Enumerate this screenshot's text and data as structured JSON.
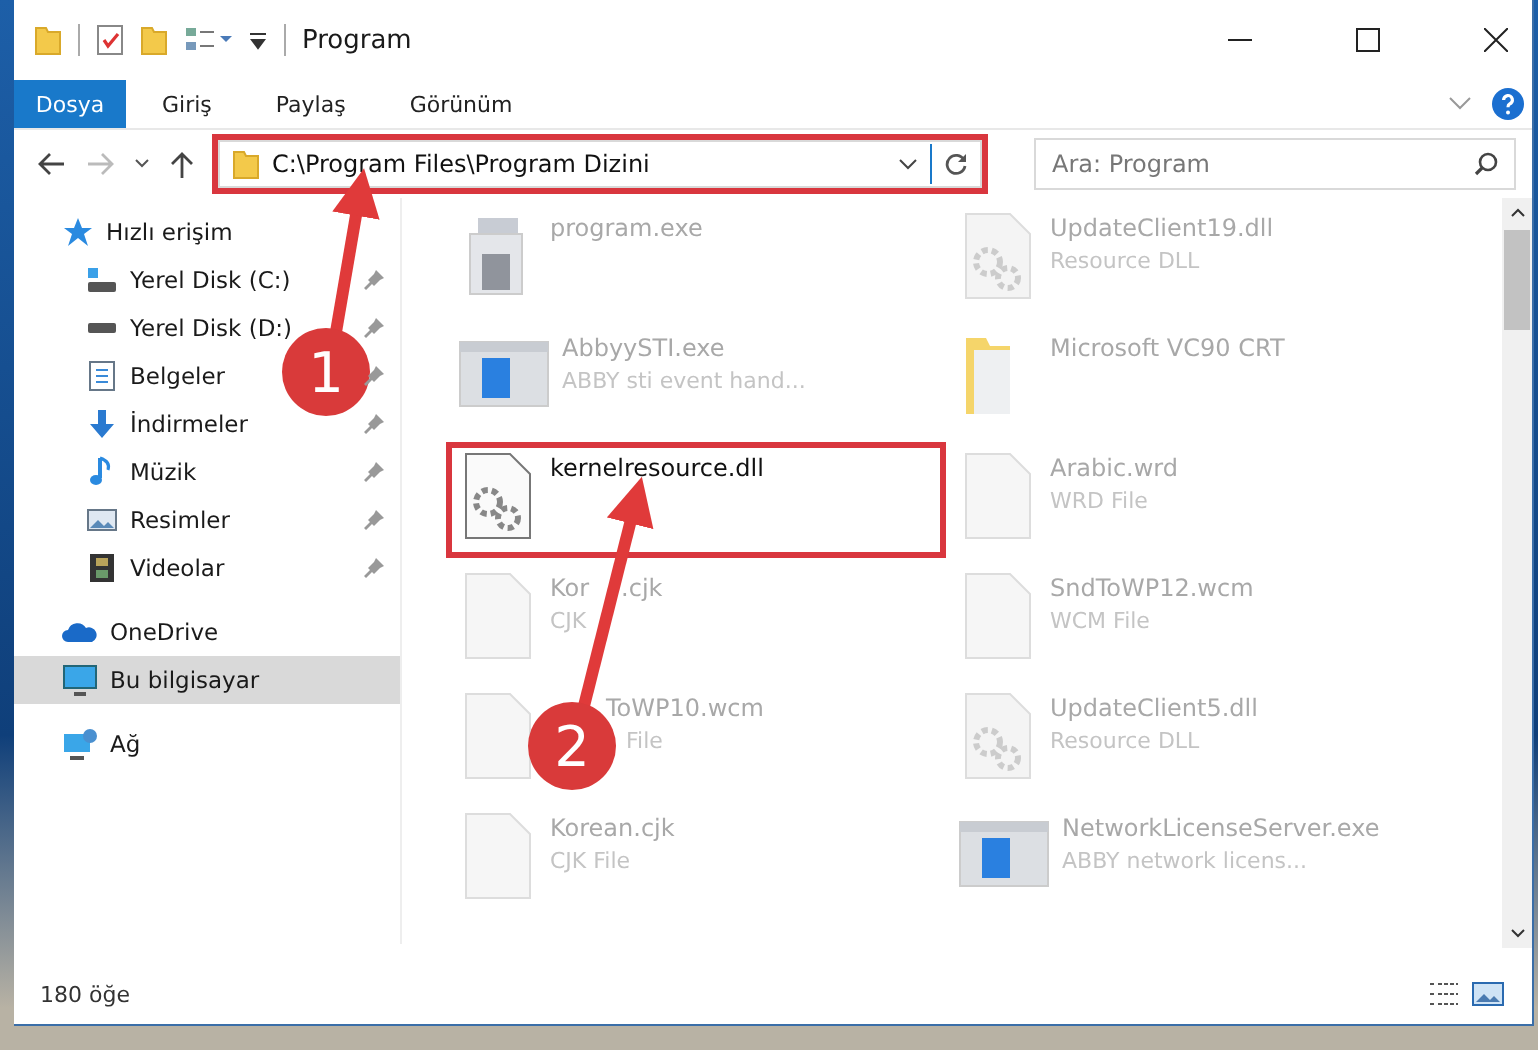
{
  "window": {
    "title": "Program"
  },
  "ribbon": {
    "tabs": [
      {
        "label": "Dosya",
        "kind": "file-menu"
      },
      {
        "label": "Giriş",
        "kind": "tab"
      },
      {
        "label": "Paylaş",
        "kind": "tab"
      },
      {
        "label": "Görünüm",
        "kind": "tab"
      }
    ]
  },
  "address_bar": {
    "value": "C:\\Program Files\\Program Dizini",
    "marked": true
  },
  "search": {
    "placeholder": "Ara: Program"
  },
  "sidebar": {
    "items": [
      {
        "label": "Hızlı erişim",
        "kind": "quick",
        "selected": false,
        "pinned": false,
        "child": false
      },
      {
        "label": "Yerel Disk (C:)",
        "kind": "disk-c",
        "selected": false,
        "pinned": true,
        "child": true
      },
      {
        "label": "Yerel Disk (D:)",
        "kind": "disk",
        "selected": false,
        "pinned": true,
        "child": true
      },
      {
        "label": "Belgeler",
        "kind": "docs",
        "selected": false,
        "pinned": true,
        "child": true
      },
      {
        "label": "İndirmeler",
        "kind": "download",
        "selected": false,
        "pinned": true,
        "child": true
      },
      {
        "label": "Müzik",
        "kind": "music",
        "selected": false,
        "pinned": true,
        "child": true
      },
      {
        "label": "Resimler",
        "kind": "pictures",
        "selected": false,
        "pinned": true,
        "child": true
      },
      {
        "label": "Videolar",
        "kind": "videos",
        "selected": false,
        "pinned": true,
        "child": true
      },
      {
        "label": "OneDrive",
        "kind": "cloud",
        "selected": false,
        "pinned": false,
        "child": false
      },
      {
        "label": "Bu bilgisayar",
        "kind": "pc",
        "selected": true,
        "pinned": false,
        "child": false
      },
      {
        "label": "Ağ",
        "kind": "network",
        "selected": false,
        "pinned": false,
        "child": false
      }
    ]
  },
  "files": [
    {
      "name": "program.exe",
      "kind": "installer",
      "marked": false
    },
    {
      "name": "UpdateClient19.dll",
      "type": "Resource DLL",
      "kind": "dll",
      "marked": false
    },
    {
      "name": "AbbyySTI.exe",
      "type": "ABBY sti event hand...",
      "kind": "app",
      "marked": false
    },
    {
      "name": "Microsoft VC90 CRT",
      "kind": "folder",
      "marked": false
    },
    {
      "name": "kernelresource.dll",
      "kind": "dll",
      "marked": true
    },
    {
      "name": "Arabic.wrd",
      "type": "WRD File",
      "kind": "file",
      "marked": false
    },
    {
      "name": "Kor",
      "name_tail": ".cjk",
      "type": "CJK",
      "kind": "file",
      "marked": false
    },
    {
      "name": "SndToWP12.wcm",
      "type": "WCM File",
      "kind": "file",
      "marked": false
    },
    {
      "name": "ToWP10.wcm",
      "type": "File",
      "kind": "file",
      "marked": false,
      "covered_start": true
    },
    {
      "name": "UpdateClient5.dll",
      "type": "Resource DLL",
      "kind": "dll",
      "marked": false
    },
    {
      "name": "Korean.cjk",
      "type": "CJK File",
      "kind": "file",
      "marked": false
    },
    {
      "name": "NetworkLicenseServer.exe",
      "type": "ABBY network licens...",
      "kind": "app",
      "marked": false
    }
  ],
  "status_bar": {
    "item_count": "180 öğe"
  },
  "callouts": [
    {
      "number": "1"
    },
    {
      "number": "2"
    }
  ]
}
